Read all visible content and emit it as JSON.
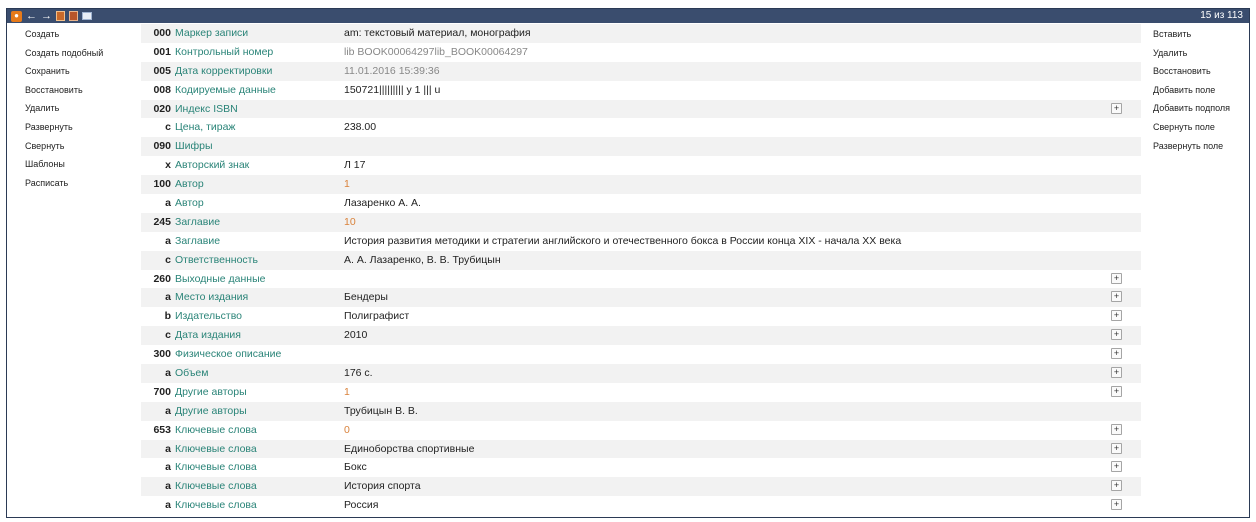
{
  "toolbar": {
    "icons": [
      "record-icon",
      "back-arrow-icon",
      "forward-arrow-icon",
      "save-record-icon",
      "delete-record-icon",
      "window-icon"
    ],
    "counter": "15 из 113"
  },
  "left_menu": [
    "Создать",
    "Создать подобный",
    "Сохранить",
    "Восстановить",
    "Удалить",
    "Развернуть",
    "Свернуть",
    "Шаблоны",
    "Расписать"
  ],
  "right_menu": [
    "Вставить",
    "Удалить",
    "Восстановить",
    "Добавить поле",
    "Добавить подполя",
    "Свернуть поле",
    "Развернуть поле"
  ],
  "rows": [
    {
      "tag": "000",
      "sub": "",
      "label": "Маркер записи",
      "value": "am: текстовый материал, монография",
      "style": "normal",
      "plus": false
    },
    {
      "tag": "001",
      "sub": "",
      "label": "Контрольный номер",
      "value": "lib BOOK00064297lib_BOOK00064297",
      "style": "gray",
      "plus": false
    },
    {
      "tag": "005",
      "sub": "",
      "label": "Дата корректировки",
      "value": "11.01.2016 15:39:36",
      "style": "gray",
      "plus": false
    },
    {
      "tag": "008",
      "sub": "",
      "label": "Кодируемые данные",
      "value": "150721||||||||| y 1 ||| u",
      "style": "normal",
      "plus": false
    },
    {
      "tag": "020",
      "sub": "",
      "label": "Индекс ISBN",
      "value": "",
      "style": "normal",
      "plus": true
    },
    {
      "tag": "",
      "sub": "c",
      "label": "Цена, тираж",
      "value": "238.00",
      "style": "normal",
      "plus": false
    },
    {
      "tag": "090",
      "sub": "",
      "label": "Шифры",
      "value": "",
      "style": "normal",
      "plus": false
    },
    {
      "tag": "",
      "sub": "x",
      "label": "Авторский знак",
      "value": "Л 17",
      "style": "normal",
      "plus": false
    },
    {
      "tag": "100",
      "sub": "",
      "label": "Автор",
      "value": "1",
      "style": "orange",
      "plus": false
    },
    {
      "tag": "",
      "sub": "a",
      "label": "Автор",
      "value": "Лазаренко А. А.",
      "style": "normal",
      "plus": false
    },
    {
      "tag": "245",
      "sub": "",
      "label": "Заглавие",
      "value": "10",
      "style": "orange",
      "plus": false
    },
    {
      "tag": "",
      "sub": "a",
      "label": "Заглавие",
      "value": "История развития методики и стратегии английского и отечественного бокса в России конца XIX - начала XX века",
      "style": "normal",
      "plus": false
    },
    {
      "tag": "",
      "sub": "c",
      "label": "Ответственность",
      "value": "А. А. Лазаренко, В. В. Трубицын",
      "style": "normal",
      "plus": false
    },
    {
      "tag": "260",
      "sub": "",
      "label": "Выходные данные",
      "value": "",
      "style": "normal",
      "plus": true
    },
    {
      "tag": "",
      "sub": "a",
      "label": "Место издания",
      "value": "Бендеры",
      "style": "normal",
      "plus": true
    },
    {
      "tag": "",
      "sub": "b",
      "label": "Издательство",
      "value": "Полиграфист",
      "style": "normal",
      "plus": true
    },
    {
      "tag": "",
      "sub": "c",
      "label": "Дата издания",
      "value": "2010",
      "style": "normal",
      "plus": true
    },
    {
      "tag": "300",
      "sub": "",
      "label": "Физическое описание",
      "value": "",
      "style": "normal",
      "plus": true
    },
    {
      "tag": "",
      "sub": "a",
      "label": "Объем",
      "value": "176 с.",
      "style": "normal",
      "plus": true
    },
    {
      "tag": "700",
      "sub": "",
      "label": "Другие авторы",
      "value": "1",
      "style": "orange",
      "plus": true
    },
    {
      "tag": "",
      "sub": "a",
      "label": "Другие авторы",
      "value": "Трубицын В. В.",
      "style": "normal",
      "plus": false
    },
    {
      "tag": "653",
      "sub": "",
      "label": "Ключевые слова",
      "value": "0",
      "style": "orange",
      "plus": true
    },
    {
      "tag": "",
      "sub": "a",
      "label": "Ключевые слова",
      "value": "Единоборства спортивные",
      "style": "normal",
      "plus": true
    },
    {
      "tag": "",
      "sub": "a",
      "label": "Ключевые слова",
      "value": "Бокс",
      "style": "normal",
      "plus": true
    },
    {
      "tag": "",
      "sub": "a",
      "label": "Ключевые слова",
      "value": "История спорта",
      "style": "normal",
      "plus": true
    },
    {
      "tag": "",
      "sub": "a",
      "label": "Ключевые слова",
      "value": "Россия",
      "style": "normal",
      "plus": true
    }
  ],
  "plus_label": "+"
}
